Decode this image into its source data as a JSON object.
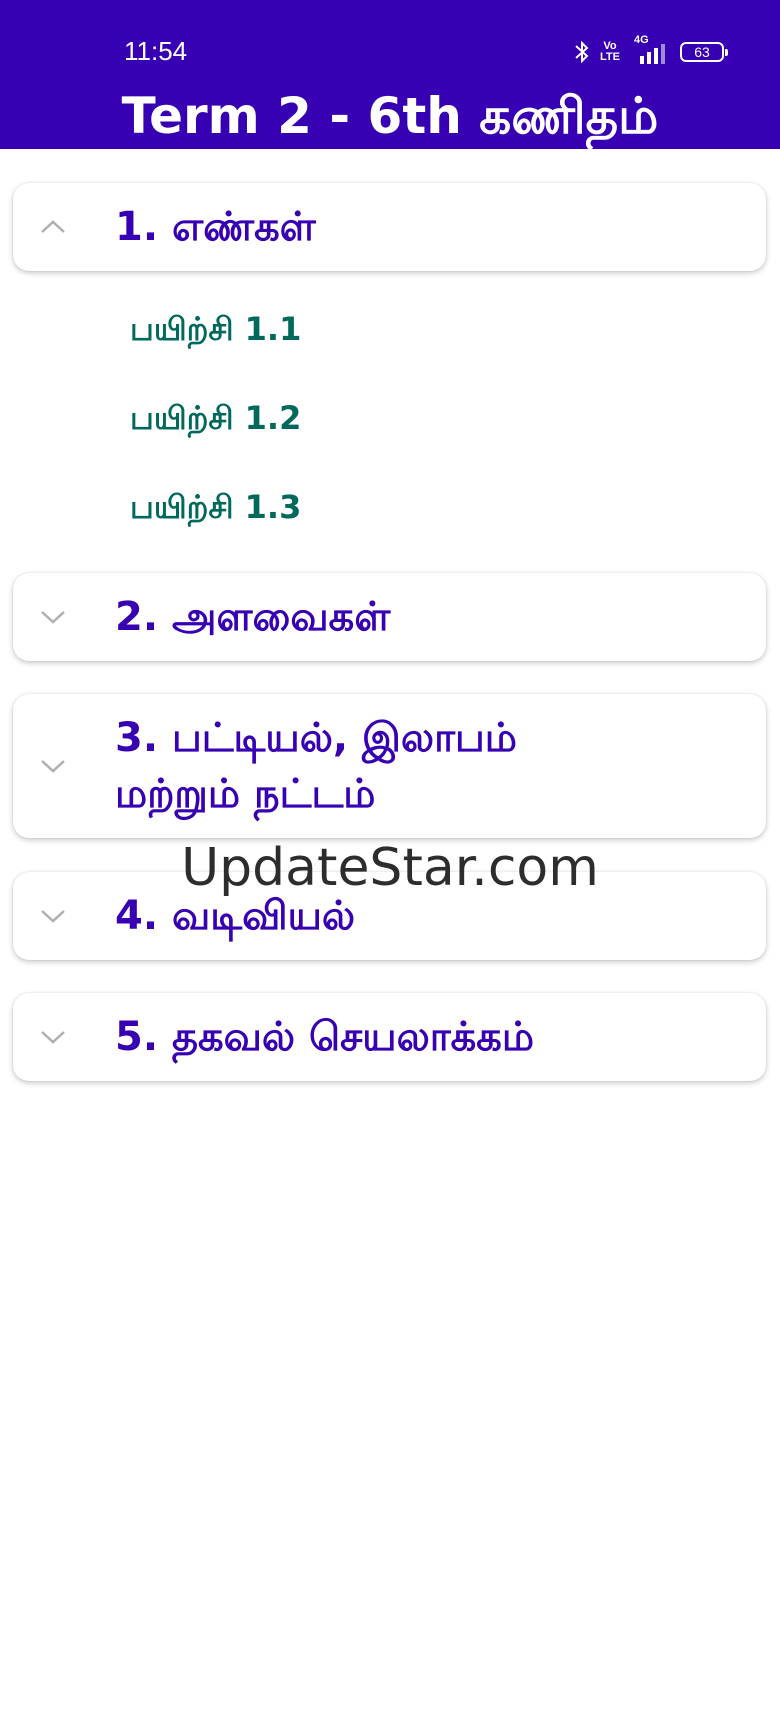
{
  "status_bar": {
    "time": "11:54",
    "volte_top": "Vo",
    "volte_bottom": "LTE",
    "network": "4G",
    "battery": "63",
    "icons": [
      "bluetooth-icon",
      "volte-icon",
      "signal-icon",
      "battery-icon"
    ]
  },
  "app": {
    "title": "Term 2 - 6th கணிதம்",
    "accent_color": "#3700b3",
    "sub_item_color": "#01695c"
  },
  "chapters": [
    {
      "label": "1. எண்கள்",
      "expanded": true,
      "exercises": [
        "பயிற்சி 1.1",
        "பயிற்சி 1.2",
        "பயிற்சி 1.3"
      ]
    },
    {
      "label": "2. அளவைகள்",
      "expanded": false
    },
    {
      "label_line1": "3. பட்டியல், இலாபம்",
      "label_line2": "மற்றும் நட்டம்",
      "expanded": false
    },
    {
      "label": "4. வடிவியல்",
      "expanded": false
    },
    {
      "label": "5. தகவல் செயலாக்கம்",
      "expanded": false
    }
  ],
  "watermark": "UpdateStar.com"
}
